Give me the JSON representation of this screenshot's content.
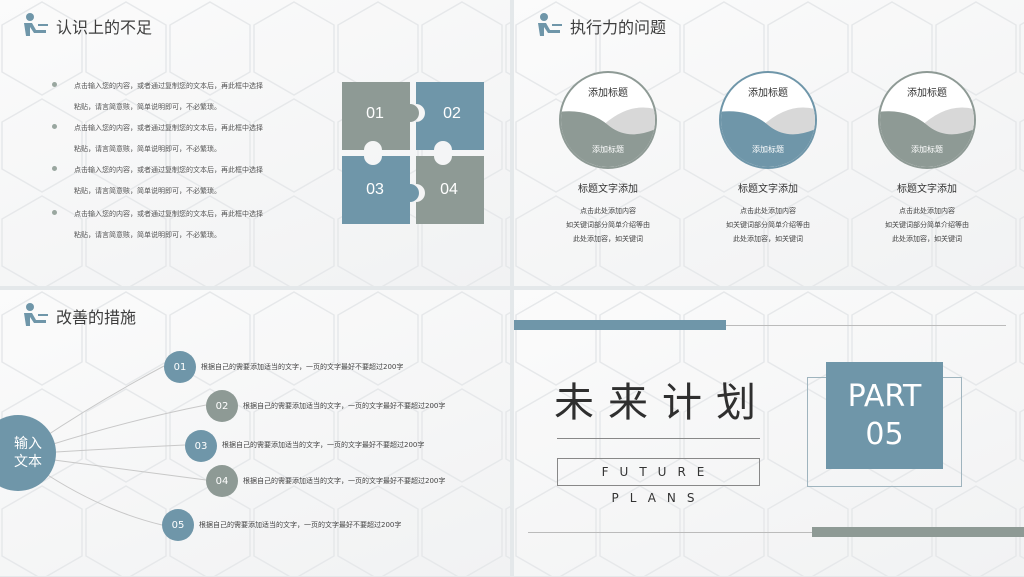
{
  "slide1": {
    "title": "认识上的不足",
    "bullets": [
      {
        "line1": "点击输入您的内容，或者通过复制您的文本后，再此框中选择",
        "line2": "粘贴，请言简意赅，简单说明即可，不必繁琐。"
      },
      {
        "line1": "点击输入您的内容，或者通过复制您的文本后，再此框中选择",
        "line2": "粘贴，请言简意赅，简单说明即可，不必繁琐。"
      },
      {
        "line1": "点击输入您的内容，或者通过复制您的文本后，再此框中选择",
        "line2": "粘贴，请言简意赅，简单说明即可，不必繁琐。"
      },
      {
        "line1": "点击输入您的内容，或者通过复制您的文本后，再此框中选择",
        "line2": "粘贴，请言简意赅，简单说明即可，不必繁琐。"
      }
    ],
    "puzzle": [
      "01",
      "02",
      "03",
      "04"
    ]
  },
  "slide2": {
    "title": "执行力的问题",
    "items": [
      {
        "circle_title": "添加标题",
        "circle_sub": "添加标题",
        "label": "标题文字添加",
        "desc1": "点击此处添加内容",
        "desc2": "如关键词部分简单介绍等由",
        "desc3": "此处添加容，如关键词",
        "color": "#8e9a95"
      },
      {
        "circle_title": "添加标题",
        "circle_sub": "添加标题",
        "label": "标题文字添加",
        "desc1": "点击此处添加内容",
        "desc2": "如关键词部分简单介绍等由",
        "desc3": "此处添加容，如关键词",
        "color": "#6f96a9"
      },
      {
        "circle_title": "添加标题",
        "circle_sub": "添加标题",
        "label": "标题文字添加",
        "desc1": "点击此处添加内容",
        "desc2": "如关键词部分简单介绍等由",
        "desc3": "此处添加容，如关键词",
        "color": "#8e9a95"
      }
    ]
  },
  "slide3": {
    "title": "改善的措施",
    "center": "输入文本",
    "nodes": [
      {
        "num": "01",
        "text": "根据自己的需要添加适当的文字，一页的文字最好不要超过200字"
      },
      {
        "num": "02",
        "text": "根据自己的需要添加适当的文字，一页的文字最好不要超过200字"
      },
      {
        "num": "03",
        "text": "根据自己的需要添加适当的文字，一页的文字最好不要超过200字"
      },
      {
        "num": "04",
        "text": "根据自己的需要添加适当的文字，一页的文字最好不要超过200字"
      },
      {
        "num": "05",
        "text": "根据自己的需要添加适当的文字，一页的文字最好不要超过200字"
      }
    ]
  },
  "slide4": {
    "title": "未来计划",
    "subtitle": "FUTURE PLANS",
    "part": "PART",
    "part_num": "05"
  },
  "colors": {
    "blue": "#6f96a9",
    "gray": "#8e9a95"
  }
}
